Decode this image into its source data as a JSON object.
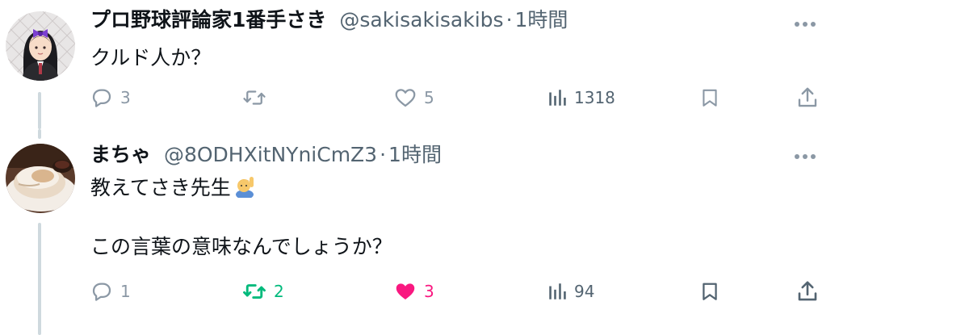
{
  "tweets": [
    {
      "name": "プロ野球評論家1番手さき",
      "handle": "@sakisakisakibs",
      "separator": "·",
      "time": "1時間",
      "lines": [
        "クルド人か？"
      ],
      "replies": "3",
      "retweets": "",
      "likes": "5",
      "views": "1318"
    },
    {
      "name": "まちゃ",
      "handle": "@8ODHXitNYniCmZ3",
      "separator": "·",
      "time": "1時間",
      "lines": [
        "教えてさき先生",
        "",
        "この言葉の意味なんでしょうか？"
      ],
      "replies": "1",
      "retweets": "2",
      "likes": "3",
      "views": "94"
    }
  ],
  "colors": {
    "icon_gray": "#8b98a5",
    "text_secondary": "#536471",
    "retweet_green": "#00ba7c",
    "like_pink": "#f91880",
    "thread_line": "#cfd9de"
  },
  "icons": [
    "reply-icon",
    "retweet-icon",
    "like-icon",
    "views-icon",
    "bookmark-icon",
    "share-icon",
    "more-icon"
  ]
}
